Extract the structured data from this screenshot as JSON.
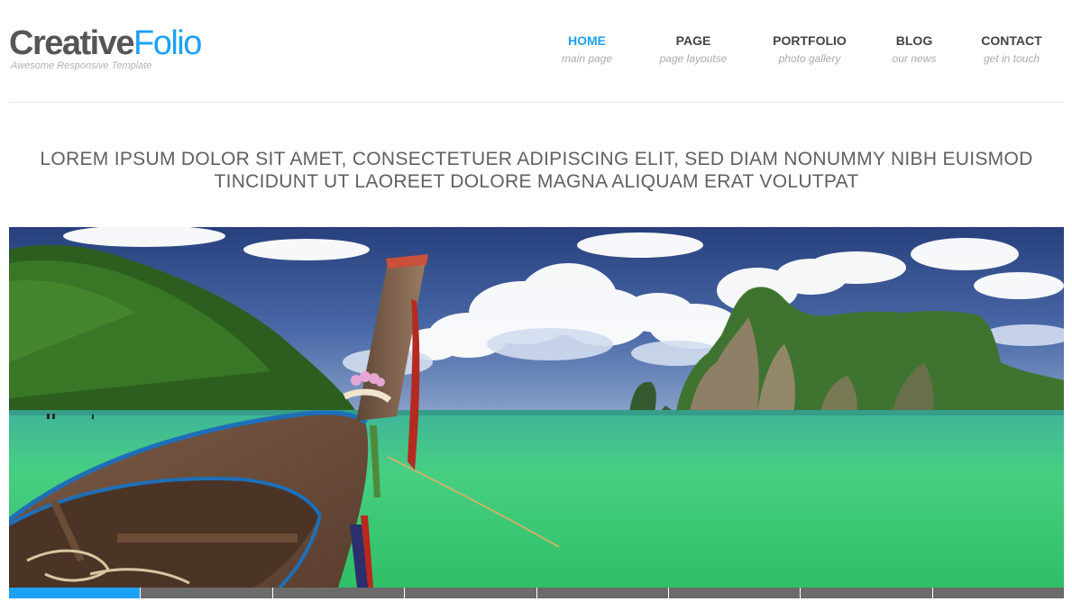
{
  "brand": {
    "name_part1": "Creative",
    "name_part2": "Folio",
    "tagline": "Awesome Responsive Template"
  },
  "nav": {
    "items": [
      {
        "label": "HOME",
        "sub": "main page",
        "active": true
      },
      {
        "label": "PAGE",
        "sub": "page layoutse",
        "active": false
      },
      {
        "label": "PORTFOLIO",
        "sub": "photo gallery",
        "active": false
      },
      {
        "label": "BLOG",
        "sub": "our news",
        "active": false
      },
      {
        "label": "CONTACT",
        "sub": "get in touch",
        "active": false
      }
    ]
  },
  "headline": "LOREM IPSUM DOLOR SIT AMET, CONSECTETUER ADIPISCING ELIT, SED DIAM NONUMMY NIBH EUISMOD TINCIDUNT UT LAOREET DOLORE MAGNA ALIQUAM ERAT VOLUTPAT",
  "slider": {
    "slide_count": 8,
    "active_index": 0
  },
  "colors": {
    "accent": "#1da1f2",
    "logo_text": "#555555",
    "nav_text": "#444444",
    "nav_sub": "#aaaaaa",
    "pager_inactive": "#6b6b6b"
  }
}
